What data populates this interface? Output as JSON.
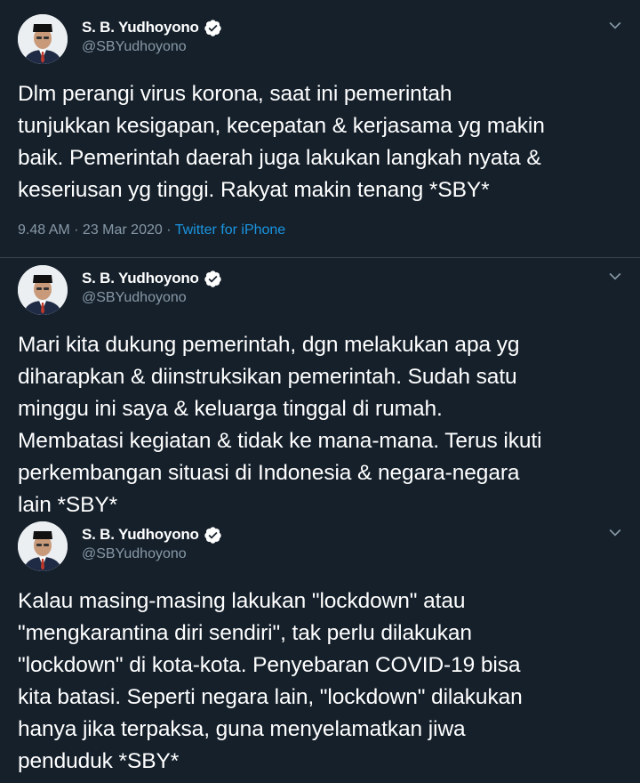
{
  "tweets": [
    {
      "display_name": "S. B. Yudhoyono",
      "handle": "@SBYudhoyono",
      "text": "Dlm perangi virus korona, saat ini pemerintah\ntunjukkan kesigapan, kecepatan & kerjasama yg makin\nbaik. Pemerintah daerah juga lakukan langkah nyata &\nkeseriusan yg tinggi. Rakyat makin tenang *SBY*",
      "time": "9.48 AM",
      "date_sep": " · ",
      "date": "23 Mar 2020",
      "source_sep": " · ",
      "source": "Twitter for iPhone"
    },
    {
      "display_name": "S. B. Yudhoyono",
      "handle": "@SBYudhoyono",
      "text": "Mari kita dukung pemerintah, dgn melakukan apa yg\ndiharapkan & diinstruksikan pemerintah. Sudah satu\nminggu ini saya & keluarga tinggal di rumah.\nMembatasi kegiatan & tidak ke mana-mana. Terus ikuti\nperkembangan situasi di Indonesia & negara-negara\nlain *SBY*"
    },
    {
      "display_name": "S. B. Yudhoyono",
      "handle": "@SBYudhoyono",
      "text": "Kalau masing-masing lakukan \"lockdown\" atau\n\"mengkarantina diri sendiri\", tak perlu dilakukan\n\"lockdown\" di kota-kota. Penyebaran COVID-19 bisa\nkita batasi. Seperti negara lain, \"lockdown\" dilakukan\nhanya jika terpaksa, guna menyelamatkan jiwa\npenduduk *SBY*"
    }
  ],
  "icons": {
    "verified": "verified-badge-icon",
    "caret": "chevron-down-icon"
  },
  "colors": {
    "background": "#15202b",
    "text": "#ffffff",
    "secondary": "#8899a6",
    "link": "#1b95e0",
    "divider": "#38444d"
  }
}
